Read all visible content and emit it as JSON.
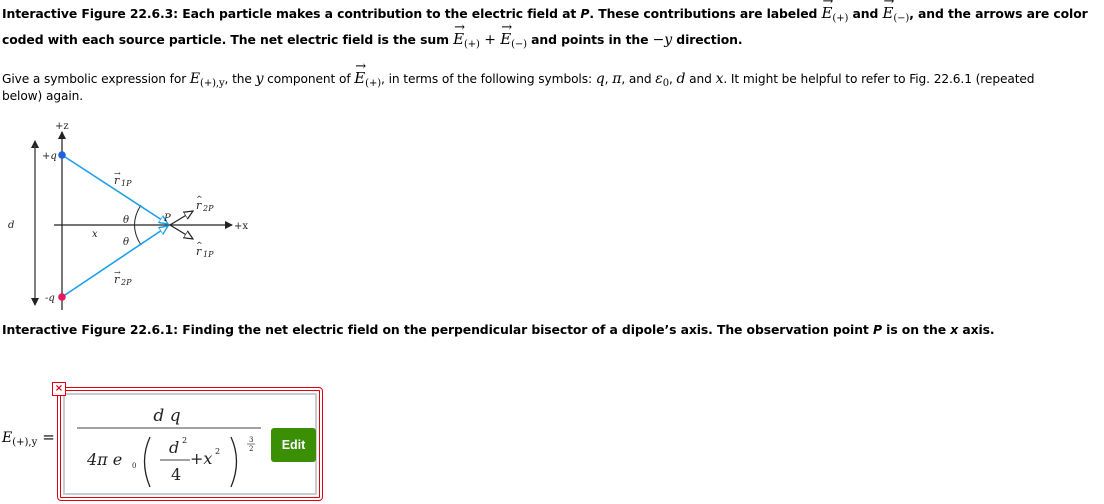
{
  "header": {
    "caption_line1_prefix": "Interactive Figure 22.6.3: Each particle makes a contribution to the electric field at ",
    "caption_line1_P": "P",
    "caption_line1_mid": ". These contributions are labeled ",
    "E_symbol": "E",
    "sub_plus": "(+)",
    "sub_minus": "(−)",
    "and": " and ",
    "caption_line1_suffix": ", and the arrows are color",
    "caption_line2_prefix": "coded with each source particle. The net electric field is the sum ",
    "plus_op": " + ",
    "caption_line2_mid": " and points in the ",
    "minus_y": "−y",
    "caption_line2_suffix": " direction."
  },
  "prompt": {
    "part1": "Give a symbolic expression for ",
    "E_plus_y_E": "E",
    "E_plus_y_sub": "(+),y",
    "part2": ", the ",
    "y": "y",
    "part3": " component of ",
    "E": "E",
    "sub_plus": "(+)",
    "part4": ", in terms of the following symbols: ",
    "q": "q",
    "comma1": ", ",
    "pi": "π",
    "part5": ", and ",
    "eps": "ε",
    "eps_sub": "0",
    "comma2": ", ",
    "d": "d",
    "and": " and ",
    "x": "x",
    "part6": ". It might be helpful to refer to Fig. 22.6.1 (repeated",
    "line2": "below) again."
  },
  "figure": {
    "labels": {
      "z_axis": "+z",
      "x_axis": "+x",
      "plus_q": "+q",
      "minus_q": "-q",
      "d": "d",
      "x": "x",
      "theta_top": "θ",
      "theta_bottom": "θ",
      "P": "P",
      "r1P_vec": "r",
      "r1P_sub": "1P",
      "r2P_vec": "r",
      "r2P_sub": "2P",
      "r2P_hat": "r",
      "r2P_hat_sub": "2P",
      "r1P_hat": "r",
      "r1P_hat_sub": "1P"
    },
    "colors": {
      "positive_charge": "#1f5fe0",
      "negative_charge": "#e8195a",
      "vector": "#1aa0ea",
      "axis": "#222222"
    },
    "caption_prefix": "Interactive Figure 22.6.1: Finding the net electric field on the perpendicular bisector of a dipole’s axis. The observation point ",
    "caption_P": "P",
    "caption_mid": " is on the ",
    "caption_x": "x",
    "caption_suffix": " axis."
  },
  "answer": {
    "label_E": "E",
    "label_sub": "(+),y",
    "equals": "=",
    "numerator": "d q",
    "den_coeff": "4π e",
    "den_coeff_sub": "0",
    "den_d": "d",
    "den_d_exp": "2",
    "den_four": "4",
    "den_plus_x": "+x",
    "den_x_exp": "2",
    "outer_exp_num": "3",
    "outer_exp_den": "2",
    "status": "incorrect",
    "error_icon": "×",
    "edit_label": "Edit",
    "colors": {
      "error_border": "#e0000e",
      "edit_button": "#3a8f04"
    }
  }
}
